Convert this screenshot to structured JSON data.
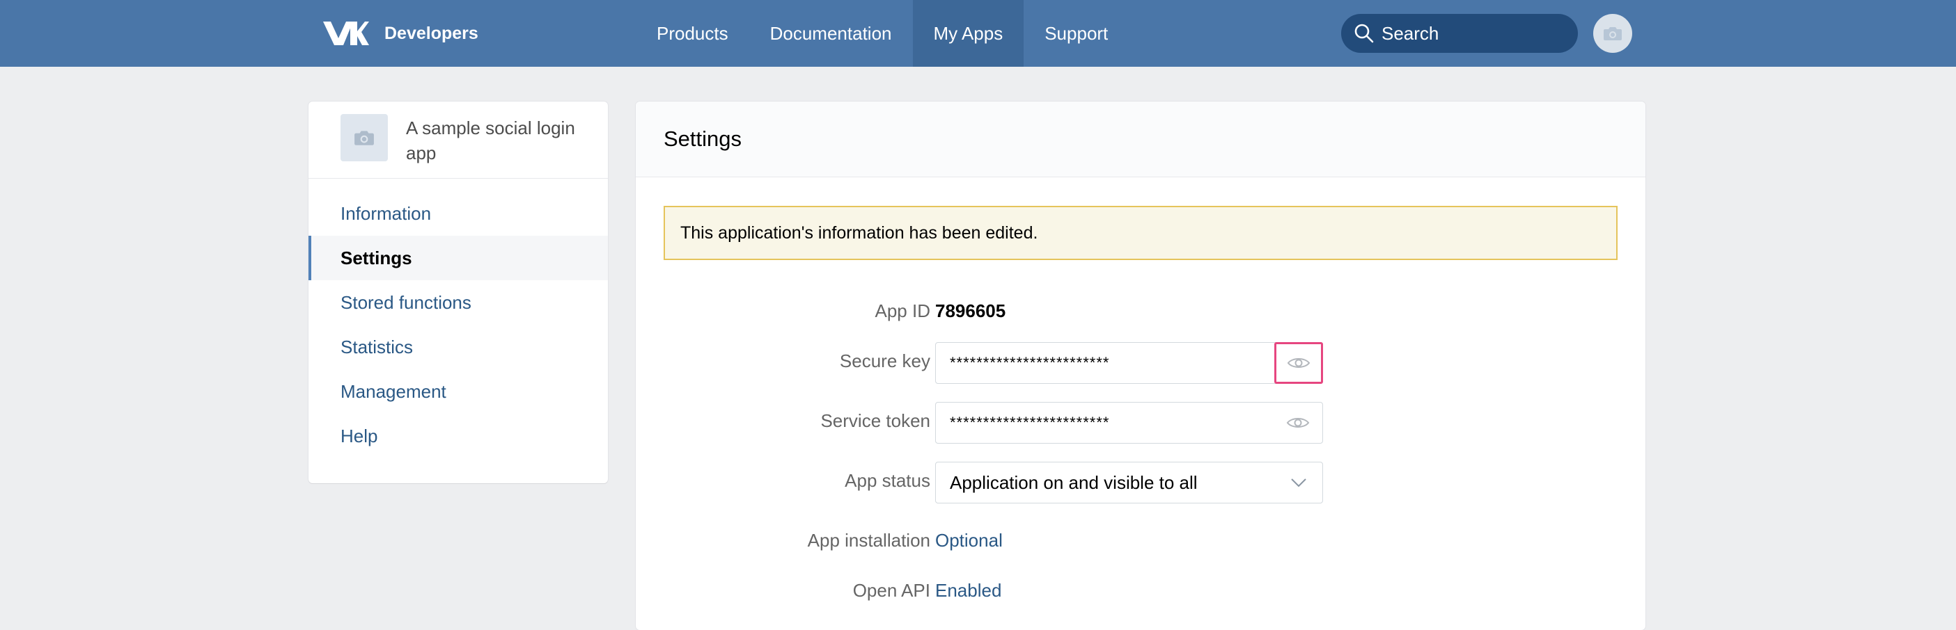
{
  "header": {
    "brand": "Developers",
    "nav": [
      {
        "label": "Products"
      },
      {
        "label": "Documentation"
      },
      {
        "label": "My Apps"
      },
      {
        "label": "Support"
      }
    ],
    "active_nav": "My Apps",
    "search_placeholder": "Search"
  },
  "sidebar": {
    "app_name": "A sample social login app",
    "items": [
      {
        "label": "Information"
      },
      {
        "label": "Settings"
      },
      {
        "label": "Stored functions"
      },
      {
        "label": "Statistics"
      },
      {
        "label": "Management"
      },
      {
        "label": "Help"
      }
    ],
    "active_item": "Settings"
  },
  "main": {
    "title": "Settings",
    "notice": "This application's information has been edited.",
    "fields": {
      "app_id": {
        "label": "App ID",
        "value": "7896605"
      },
      "secure_key": {
        "label": "Secure key",
        "value": "************************"
      },
      "service_token": {
        "label": "Service token",
        "value": "************************"
      },
      "app_status": {
        "label": "App status",
        "value": "Application on and visible to all"
      },
      "app_installation": {
        "label": "App installation",
        "value": "Optional"
      },
      "open_api": {
        "label": "Open API",
        "value": "Enabled"
      }
    }
  },
  "colors": {
    "header_bg": "#4a76a8",
    "active_nav_bg": "#3d6898",
    "link": "#2a5885",
    "notice_bg": "#f9f6e7",
    "notice_border": "#e5c45b",
    "focus_ring": "#e64680"
  },
  "icons": {
    "logo": "vk-logo-icon",
    "search": "search-icon",
    "avatar": "camera-icon",
    "reveal": "eye-icon",
    "dropdown": "chevron-down-icon"
  }
}
